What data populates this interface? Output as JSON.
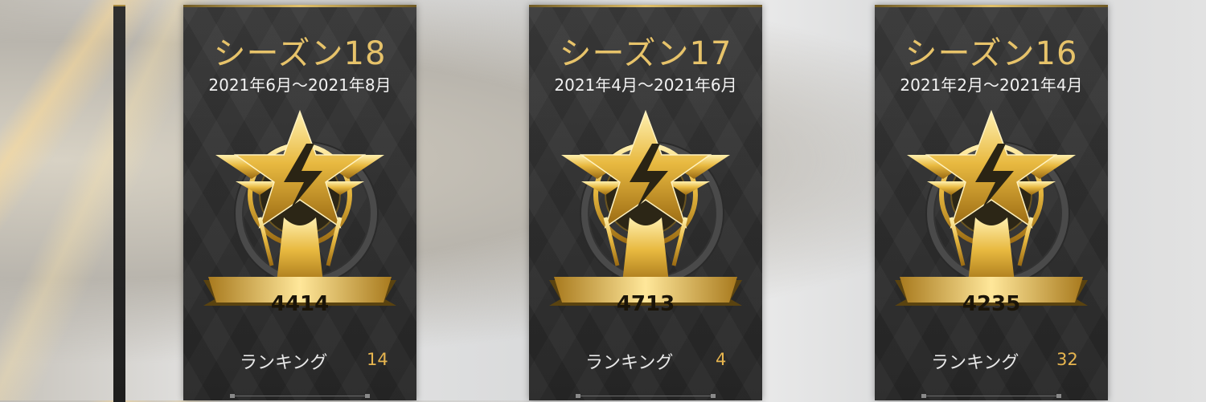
{
  "cards": [
    {
      "title": "シーズン18",
      "dates": "2021年6月～2021年8月",
      "score": "4414",
      "rank_label": "ランキング",
      "rank_value": "14"
    },
    {
      "title": "シーズン17",
      "dates": "2021年4月～2021年6月",
      "score": "4713",
      "rank_label": "ランキング",
      "rank_value": "4"
    },
    {
      "title": "シーズン16",
      "dates": "2021年2月～2021年4月",
      "score": "4235",
      "rank_label": "ランキング",
      "rank_value": "32"
    }
  ],
  "colors": {
    "gold": "#e7c36a",
    "rank_accent": "#e7b54f",
    "card_bg": "#2f2f2f"
  },
  "icons": {
    "emblem": "gold-winged-star-emblem-icon"
  }
}
